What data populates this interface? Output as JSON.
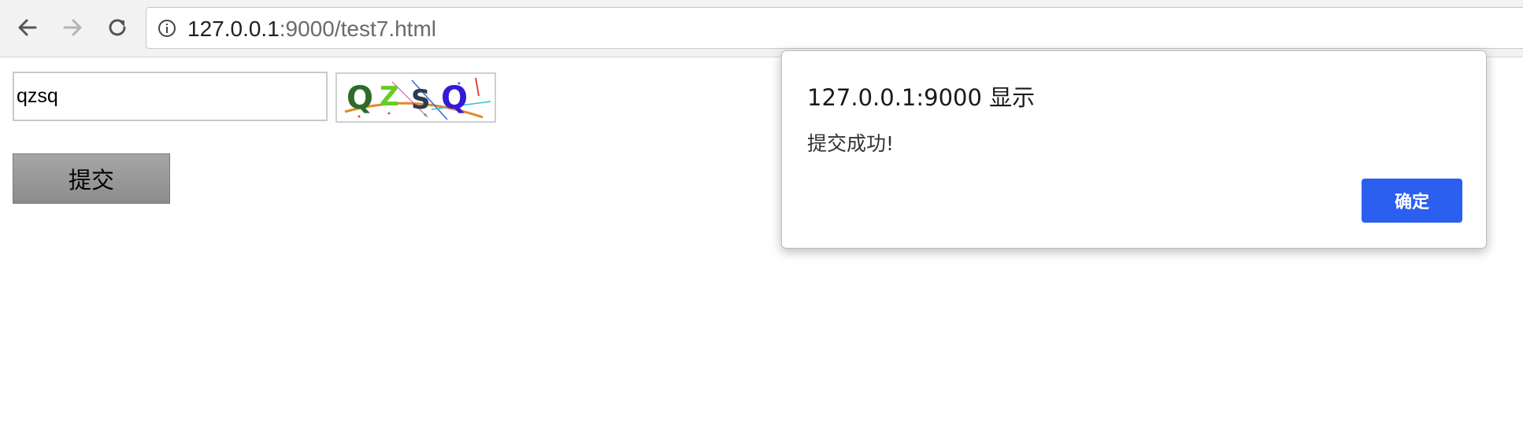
{
  "browser": {
    "url_host": "127.0.0.1",
    "url_rest": ":9000/test7.html",
    "icons": [
      "back-arrow-icon",
      "forward-arrow-icon",
      "reload-icon",
      "info-icon"
    ]
  },
  "page": {
    "captcha_input_value": "qzsq",
    "captcha_text": "QZSQ",
    "submit_label": "提交"
  },
  "dialog": {
    "title": "127.0.0.1:9000 显示",
    "message": "提交成功!",
    "ok_label": "确定"
  },
  "colors": {
    "accent": "#2a5ff0",
    "submit_bg": "#999999"
  }
}
